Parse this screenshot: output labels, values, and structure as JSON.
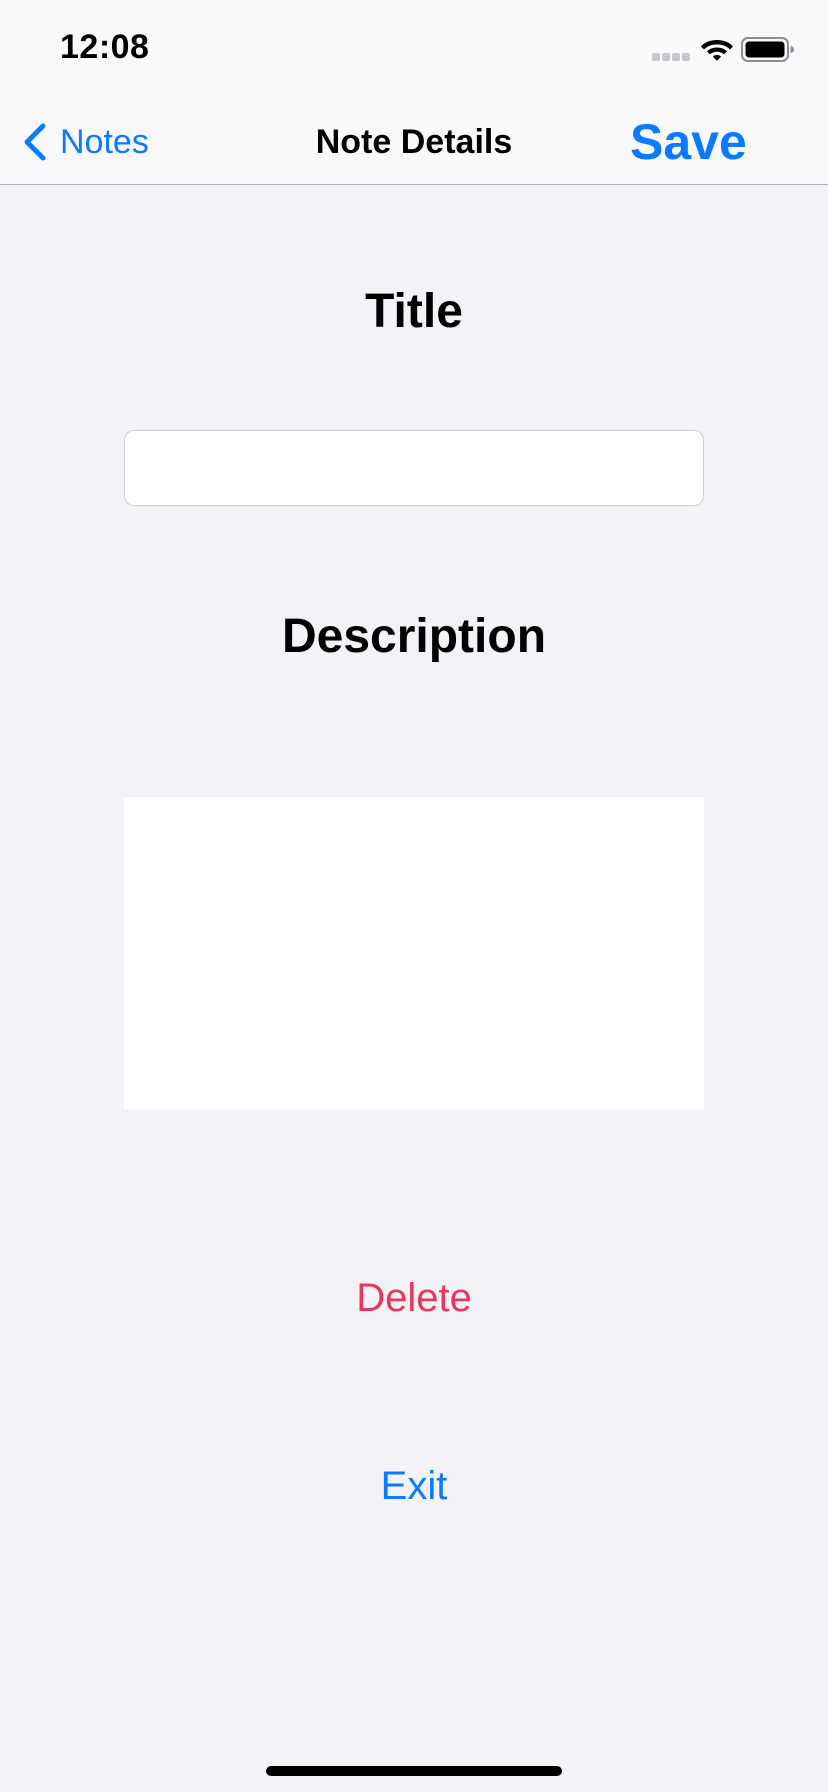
{
  "status_bar": {
    "time": "12:08",
    "icons": [
      "signal-dots-icon",
      "wifi-icon",
      "battery-icon"
    ]
  },
  "nav": {
    "back_label": "Notes",
    "title": "Note Details",
    "save_label": "Save"
  },
  "form": {
    "title_heading": "Title",
    "title_value": "",
    "title_placeholder": "",
    "description_heading": "Description",
    "description_value": ""
  },
  "actions": {
    "delete_label": "Delete",
    "exit_label": "Exit"
  },
  "colors": {
    "accent": "#0a7aff",
    "destructive": "#e8375c",
    "background": "#f2f2f7",
    "bar_background": "#f9f9fb"
  }
}
